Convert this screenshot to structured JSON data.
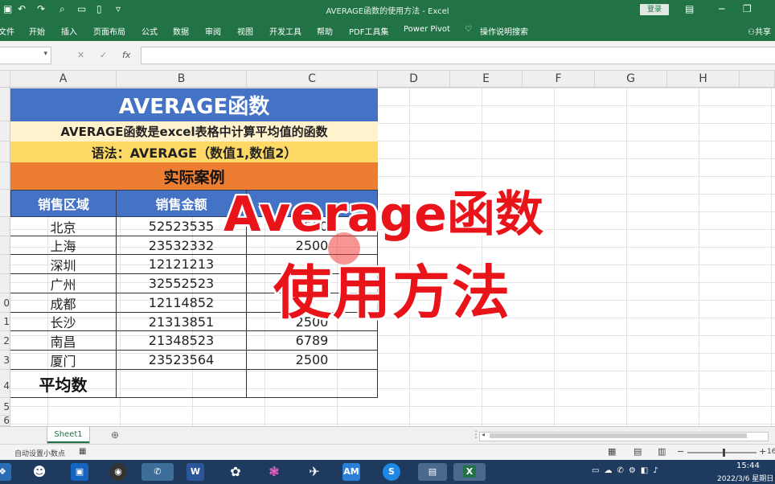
{
  "app": {
    "title": "AVERAGE函数的使用方法  -  Excel",
    "login": "登录",
    "menu": [
      "文件",
      "开始",
      "插入",
      "页面布局",
      "公式",
      "数据",
      "审阅",
      "视图",
      "开发工具",
      "帮助",
      "PDF工具集",
      "Power Pivot",
      "操作说明搜索",
      "共享"
    ]
  },
  "formula_bar": {
    "fx": "fx",
    "cancel": "✕",
    "enter": "✓"
  },
  "columns": [
    "A",
    "B",
    "C",
    "D",
    "E",
    "F",
    "G",
    "H"
  ],
  "rows": [
    "",
    "",
    "",
    "",
    "",
    "",
    "",
    "",
    "0",
    "1",
    "2",
    "3",
    "4",
    "5",
    "6"
  ],
  "table": {
    "title": "AVERAGE函数",
    "description": "AVERAGE函数是excel表格中计算平均值的函数",
    "syntax": "语法：AVERAGE（数值1,数值2）",
    "case_header": "实际案例",
    "headers": [
      "销售区域",
      "销售金额",
      ""
    ],
    "data": [
      [
        "北京",
        "52523535",
        "2500"
      ],
      [
        "上海",
        "23532332",
        "2500"
      ],
      [
        "深圳",
        "12121213",
        ""
      ],
      [
        "广州",
        "32552523",
        ""
      ],
      [
        "成都",
        "12114852",
        ""
      ],
      [
        "长沙",
        "21313851",
        "2500"
      ],
      [
        "南昌",
        "21348523",
        "6789"
      ],
      [
        "厦门",
        "23523564",
        "2500"
      ]
    ],
    "average_label": "平均数"
  },
  "overlay": {
    "line1": "Average函数",
    "line2": "使用方法"
  },
  "sheet_tab": "Sheet1",
  "status": {
    "left": "自动设置小数点",
    "zoom": "16"
  },
  "taskbar": {
    "time": "15:44",
    "date": "2022/3/6 星期日"
  }
}
